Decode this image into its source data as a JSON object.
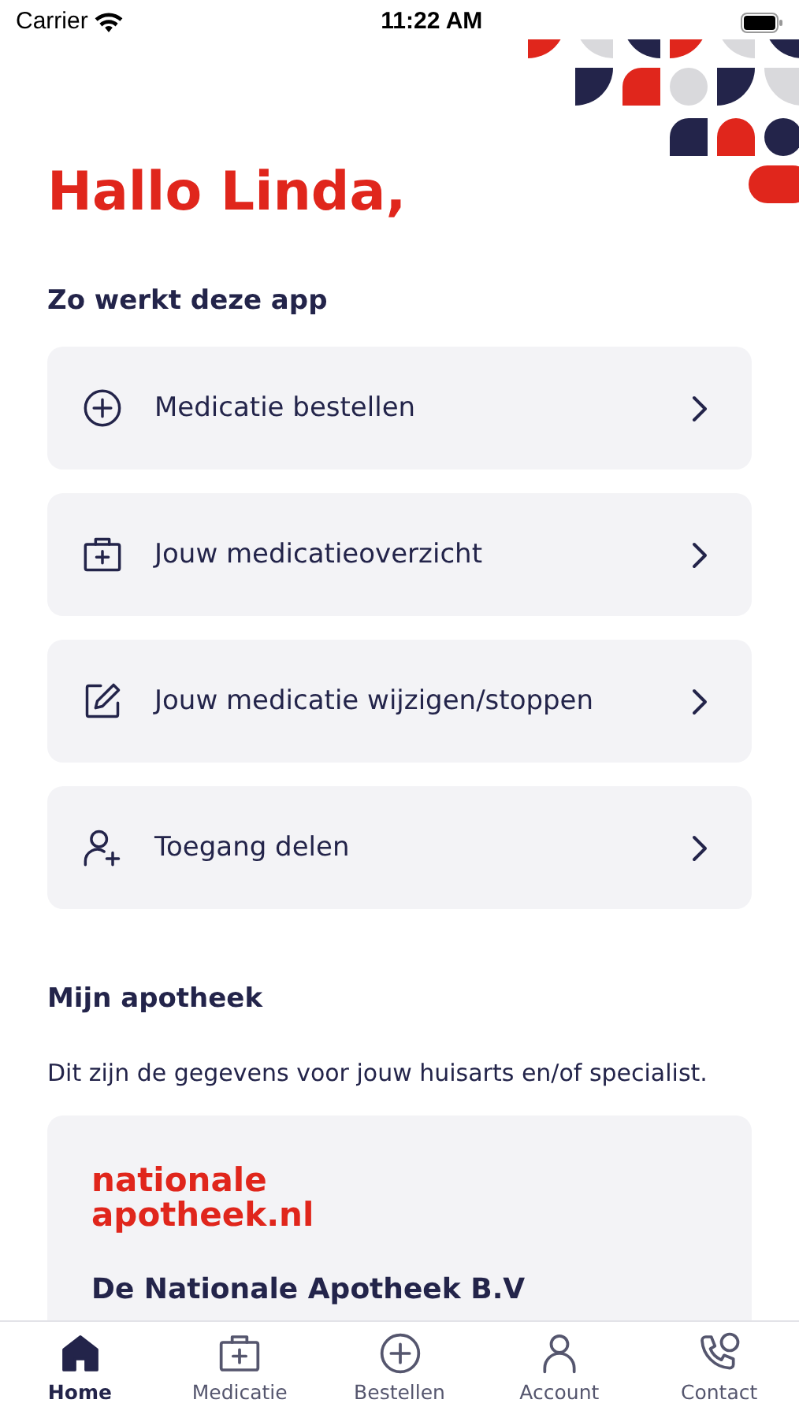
{
  "status_bar": {
    "carrier": "Carrier",
    "time": "11:22 AM"
  },
  "greeting": "Hallo Linda,",
  "how_it_works": {
    "heading": "Zo werkt deze app",
    "items": [
      {
        "kind": "order",
        "label": "Medicatie bestellen"
      },
      {
        "kind": "overview",
        "label": "Jouw medicatieoverzicht"
      },
      {
        "kind": "edit",
        "label": "Jouw medicatie wijzigen/stoppen"
      },
      {
        "kind": "share",
        "label": "Toegang delen"
      }
    ]
  },
  "pharmacy": {
    "heading": "Mijn apotheek",
    "description": "Dit zijn de gegevens voor jouw huisarts en/of specialist.",
    "logo_lines": [
      "nationale",
      "apotheek.nl"
    ],
    "name": "De Nationale Apotheek B.V"
  },
  "tab_bar": [
    {
      "kind": "home",
      "label": "Home",
      "selected": true
    },
    {
      "kind": "medication",
      "label": "Medicatie",
      "selected": false
    },
    {
      "kind": "order",
      "label": "Bestellen",
      "selected": false
    },
    {
      "kind": "account",
      "label": "Account",
      "selected": false
    },
    {
      "kind": "contact",
      "label": "Contact",
      "selected": false
    }
  ]
}
